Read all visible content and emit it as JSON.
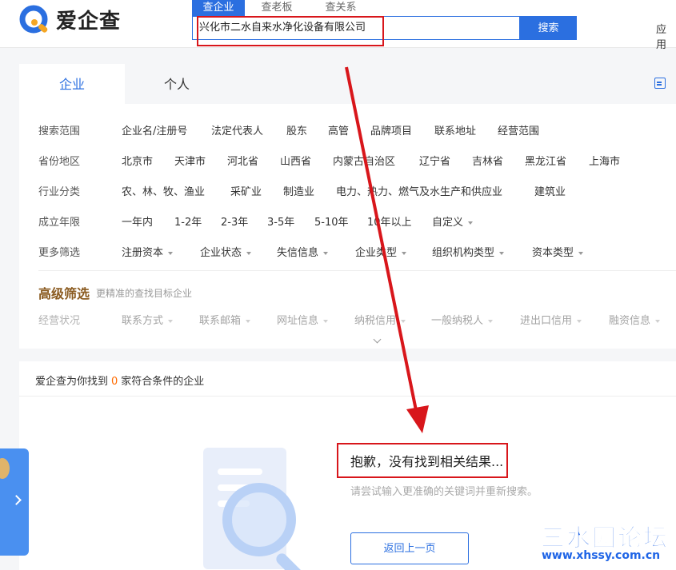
{
  "header": {
    "logo_text": "爱企查",
    "search_tabs": [
      "查企业",
      "查老板",
      "查关系"
    ],
    "search_value": "兴化市二水自来水净化设备有限公司",
    "search_button": "搜索",
    "right_link": "应用"
  },
  "tabs": {
    "company": "企业",
    "person": "个人"
  },
  "filters": {
    "scope": {
      "label": "搜索范围",
      "items": [
        "企业名/注册号",
        "法定代表人",
        "股东",
        "高管",
        "品牌项目",
        "联系地址",
        "经营范围"
      ]
    },
    "region": {
      "label": "省份地区",
      "items": [
        "北京市",
        "天津市",
        "河北省",
        "山西省",
        "内蒙古自治区",
        "辽宁省",
        "吉林省",
        "黑龙江省",
        "上海市"
      ]
    },
    "industry": {
      "label": "行业分类",
      "items": [
        "农、林、牧、渔业",
        "采矿业",
        "制造业",
        "电力、热力、燃气及水生产和供应业",
        "建筑业"
      ]
    },
    "founded": {
      "label": "成立年限",
      "items": [
        "一年内",
        "1-2年",
        "2-3年",
        "3-5年",
        "5-10年",
        "10年以上",
        "自定义"
      ]
    },
    "more": {
      "label": "更多筛选",
      "items": [
        "注册资本",
        "企业状态",
        "失信信息",
        "企业类型",
        "组织机构类型",
        "资本类型"
      ]
    }
  },
  "advanced": {
    "title": "高级筛选",
    "subtitle": "更精准的查找目标企业",
    "label": "经营状况",
    "items": [
      "联系方式",
      "联系邮箱",
      "网址信息",
      "纳税信用",
      "一般纳税人",
      "进出口信用",
      "融资信息"
    ]
  },
  "results": {
    "prefix": "爱企查为你找到",
    "count": "0",
    "suffix": "家符合条件的企业",
    "sorry": "抱歉，没有找到相关结果...",
    "hint": "请尝试输入更准确的关键词并重新搜索。",
    "back_button": "返回上一页"
  },
  "watermark": {
    "main": "三水园论坛",
    "sub": "www.xhssy.com.cn"
  },
  "colors": {
    "primary": "#2b6fe0",
    "highlight": "#d8161b",
    "count": "#ff6b00",
    "advanced": "#8a5a1f"
  }
}
